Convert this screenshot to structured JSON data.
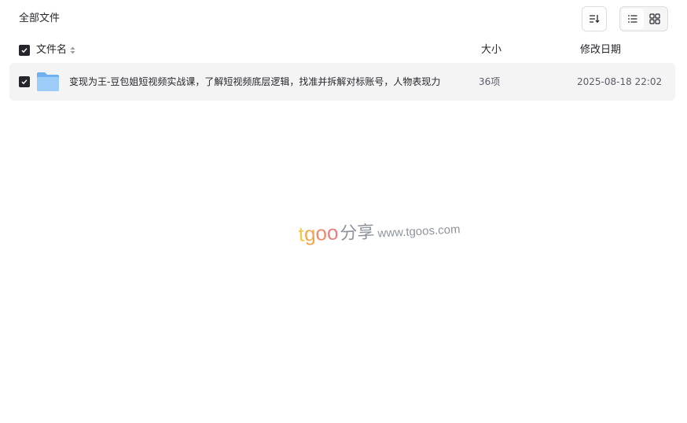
{
  "header": {
    "title": "全部文件"
  },
  "columns": {
    "name": "文件名",
    "size": "大小",
    "date": "修改日期"
  },
  "files": [
    {
      "name": "变现为王-豆包姐短视频实战课，了解短视频底层逻辑，找准并拆解对标账号，人物表现力",
      "size": "36项",
      "date": "2025-08-18 22:02",
      "icon": "folder-icon",
      "selected": true
    }
  ],
  "watermark": {
    "brand_t": "t",
    "brand_g": "g",
    "brand_o1": "o",
    "brand_o2": "o",
    "brand_cn": "分享",
    "url": "www.tgoos.com"
  },
  "colors": {
    "row_bg": "#f4f4f5",
    "text": "#25262b",
    "muted": "#5c5e66",
    "checkbox": "#25262b",
    "folder": "#8cc4f5"
  }
}
